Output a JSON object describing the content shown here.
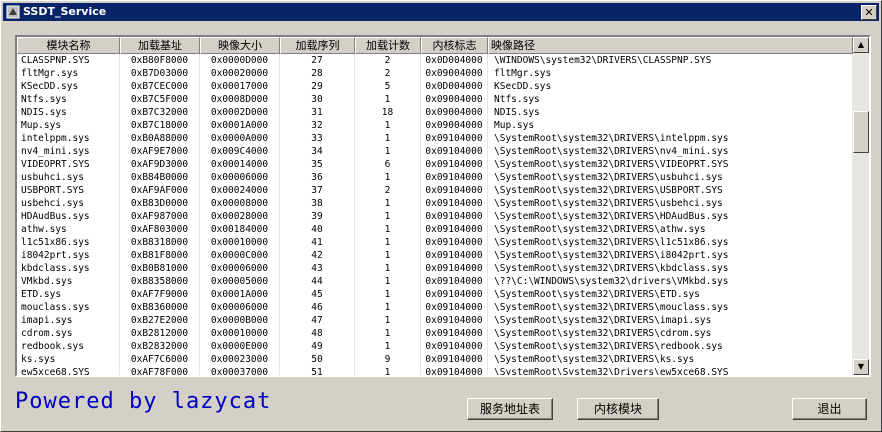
{
  "window": {
    "title": "SSDT_Service",
    "close_glyph": "✕"
  },
  "columns": [
    "模块名称",
    "加载基址",
    "映像大小",
    "加载序列",
    "加载计数",
    "内核标志",
    "映像路径"
  ],
  "rows": [
    [
      "CLASSPNP.SYS",
      "0xB80F8000",
      "0x0000D000",
      "27",
      "2",
      "0x0D004000",
      "\\WINDOWS\\system32\\DRIVERS\\CLASSPNP.SYS"
    ],
    [
      "fltMgr.sys",
      "0xB7D03000",
      "0x00020000",
      "28",
      "2",
      "0x09004000",
      "fltMgr.sys"
    ],
    [
      "KSecDD.sys",
      "0xB7CEC000",
      "0x00017000",
      "29",
      "5",
      "0x0D004000",
      "KSecDD.sys"
    ],
    [
      "Ntfs.sys",
      "0xB7C5F000",
      "0x0008D000",
      "30",
      "1",
      "0x09004000",
      "Ntfs.sys"
    ],
    [
      "NDIS.sys",
      "0xB7C32000",
      "0x0002D000",
      "31",
      "18",
      "0x09004000",
      "NDIS.sys"
    ],
    [
      "Mup.sys",
      "0xB7C18000",
      "0x0001A000",
      "32",
      "1",
      "0x09004000",
      "Mup.sys"
    ],
    [
      "intelppm.sys",
      "0xB0A88000",
      "0x0000A000",
      "33",
      "1",
      "0x09104000",
      "\\SystemRoot\\system32\\DRIVERS\\intelppm.sys"
    ],
    [
      "nv4_mini.sys",
      "0xAF9E7000",
      "0x009C4000",
      "34",
      "1",
      "0x09104000",
      "\\SystemRoot\\system32\\DRIVERS\\nv4_mini.sys"
    ],
    [
      "VIDEOPRT.SYS",
      "0xAF9D3000",
      "0x00014000",
      "35",
      "6",
      "0x09104000",
      "\\SystemRoot\\system32\\DRIVERS\\VIDEOPRT.SYS"
    ],
    [
      "usbuhci.sys",
      "0xB84B0000",
      "0x00006000",
      "36",
      "1",
      "0x09104000",
      "\\SystemRoot\\system32\\DRIVERS\\usbuhci.sys"
    ],
    [
      "USBPORT.SYS",
      "0xAF9AF000",
      "0x00024000",
      "37",
      "2",
      "0x09104000",
      "\\SystemRoot\\system32\\DRIVERS\\USBPORT.SYS"
    ],
    [
      "usbehci.sys",
      "0xB83D0000",
      "0x00008000",
      "38",
      "1",
      "0x09104000",
      "\\SystemRoot\\system32\\DRIVERS\\usbehci.sys"
    ],
    [
      "HDAudBus.sys",
      "0xAF987000",
      "0x00028000",
      "39",
      "1",
      "0x09104000",
      "\\SystemRoot\\system32\\DRIVERS\\HDAudBus.sys"
    ],
    [
      "athw.sys",
      "0xAF803000",
      "0x00184000",
      "40",
      "1",
      "0x09104000",
      "\\SystemRoot\\system32\\DRIVERS\\athw.sys"
    ],
    [
      "l1c51x86.sys",
      "0xB8318000",
      "0x00010000",
      "41",
      "1",
      "0x09104000",
      "\\SystemRoot\\system32\\DRIVERS\\l1c51x86.sys"
    ],
    [
      "i8042prt.sys",
      "0xB81F8000",
      "0x0000C000",
      "42",
      "1",
      "0x09104000",
      "\\SystemRoot\\system32\\DRIVERS\\i8042prt.sys"
    ],
    [
      "kbdclass.sys",
      "0xB0B81000",
      "0x00006000",
      "43",
      "1",
      "0x09104000",
      "\\SystemRoot\\system32\\DRIVERS\\kbdclass.sys"
    ],
    [
      "VMkbd.sys",
      "0xB8358000",
      "0x00005000",
      "44",
      "1",
      "0x09104000",
      "\\??\\C:\\WINDOWS\\system32\\drivers\\VMkbd.sys"
    ],
    [
      "ETD.sys",
      "0xAF7F9000",
      "0x0001A000",
      "45",
      "1",
      "0x09104000",
      "\\SystemRoot\\system32\\DRIVERS\\ETD.sys"
    ],
    [
      "mouclass.sys",
      "0xB8360000",
      "0x00006000",
      "46",
      "1",
      "0x09104000",
      "\\SystemRoot\\system32\\DRIVERS\\mouclass.sys"
    ],
    [
      "imapi.sys",
      "0xB27E2000",
      "0x0000B000",
      "47",
      "1",
      "0x09104000",
      "\\SystemRoot\\system32\\DRIVERS\\imapi.sys"
    ],
    [
      "cdrom.sys",
      "0xB2812000",
      "0x00010000",
      "48",
      "1",
      "0x09104000",
      "\\SystemRoot\\system32\\DRIVERS\\cdrom.sys"
    ],
    [
      "redbook.sys",
      "0xB2832000",
      "0x0000E000",
      "49",
      "1",
      "0x09104000",
      "\\SystemRoot\\system32\\DRIVERS\\redbook.sys"
    ],
    [
      "ks.sys",
      "0xAF7C6000",
      "0x00023000",
      "50",
      "9",
      "0x09104000",
      "\\SystemRoot\\system32\\DRIVERS\\ks.sys"
    ],
    [
      "ew5xce68.SYS",
      "0xAF78F000",
      "0x00037000",
      "51",
      "1",
      "0x09104000",
      "\\SystemRoot\\System32\\Drivers\\ew5xce68.SYS"
    ]
  ],
  "scroll": {
    "up_glyph": "▲",
    "down_glyph": "▼"
  },
  "footer": {
    "powered_text": "Powered by lazycat",
    "btn_service_table": "服务地址表",
    "btn_kernel_module": "内核模块",
    "btn_exit": "退出"
  }
}
